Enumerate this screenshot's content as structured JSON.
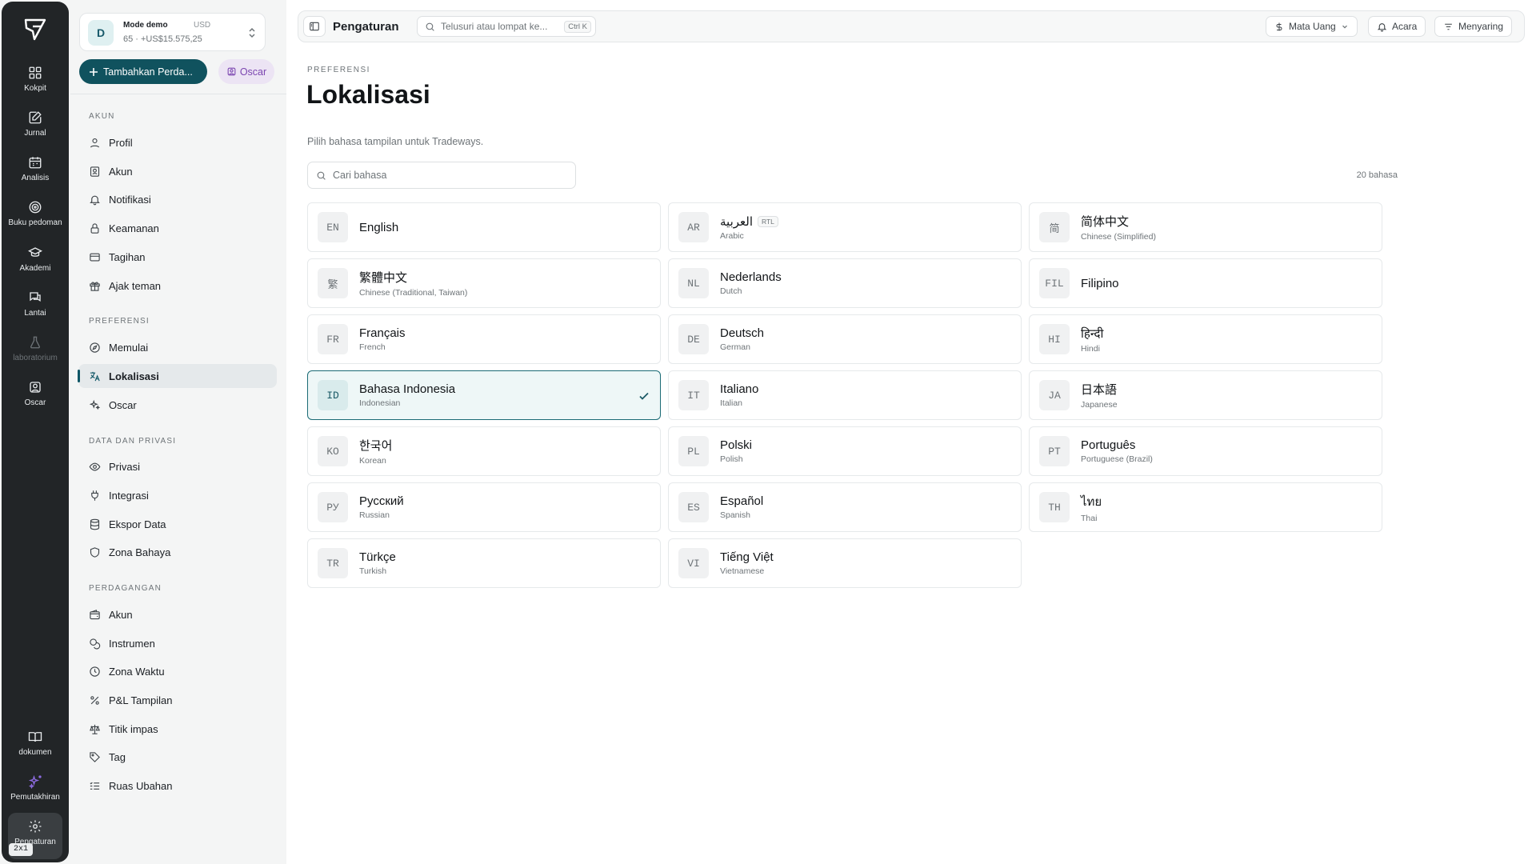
{
  "rail": {
    "items": [
      {
        "label": "Kokpit",
        "icon": "grid-icon"
      },
      {
        "label": "Jurnal",
        "icon": "edit-note-icon"
      },
      {
        "label": "Analisis",
        "icon": "calendar-icon"
      },
      {
        "label": "Buku pedoman",
        "icon": "target-icon"
      },
      {
        "label": "Akademi",
        "icon": "graduation-cap-icon"
      },
      {
        "label": "Lantai",
        "icon": "chat-icon"
      },
      {
        "label": "laboratorium",
        "icon": "flask-icon"
      },
      {
        "label": "Oscar",
        "icon": "bot-icon"
      }
    ],
    "bottom": [
      {
        "label": "dokumen",
        "icon": "book-icon"
      },
      {
        "label": "Pemutakhiran",
        "icon": "sparkles-icon"
      },
      {
        "label": "Pengaturan",
        "icon": "gear-icon"
      }
    ],
    "badge": "2x1"
  },
  "account": {
    "avatar": "D",
    "name": "Mode demo",
    "currency": "USD",
    "sub": "65 · +US$15.575,25"
  },
  "actions": {
    "add_label": "Tambahkan Perda...",
    "oscar_label": "Oscar"
  },
  "sidebar": {
    "sections": [
      {
        "title": "AKUN",
        "items": [
          "Profil",
          "Akun",
          "Notifikasi",
          "Keamanan",
          "Tagihan",
          "Ajak teman"
        ]
      },
      {
        "title": "PREFERENSI",
        "items": [
          "Memulai",
          "Lokalisasi",
          "Oscar"
        ]
      },
      {
        "title": "DATA DAN PRIVASI",
        "items": [
          "Privasi",
          "Integrasi",
          "Ekspor Data",
          "Zona Bahaya"
        ]
      },
      {
        "title": "PERDAGANGAN",
        "items": [
          "Akun",
          "Instrumen",
          "Zona Waktu",
          "P&L Tampilan",
          "Titik impas",
          "Tag",
          "Ruas Ubahan"
        ]
      }
    ],
    "active": "Lokalisasi"
  },
  "topbar": {
    "title": "Pengaturan",
    "search_placeholder": "Telusuri atau lompat ke...",
    "shortcut": "Ctrl K",
    "currency_label": "Mata Uang",
    "events_label": "Acara",
    "filter_label": "Menyaring"
  },
  "page": {
    "eyebrow": "PREFERENSI",
    "title": "Lokalisasi",
    "description": "Pilih bahasa tampilan untuk Tradeways.",
    "search_placeholder": "Cari bahasa",
    "count": "20 bahasa"
  },
  "accent_color": "#10525e",
  "languages": [
    {
      "code": "EN",
      "native": "English",
      "english": ""
    },
    {
      "code": "AR",
      "native": "العربية",
      "english": "Arabic",
      "badge": "RTL"
    },
    {
      "code": "简",
      "native": "简体中文",
      "english": "Chinese (Simplified)"
    },
    {
      "code": "繁",
      "native": "繁體中文",
      "english": "Chinese (Traditional, Taiwan)"
    },
    {
      "code": "NL",
      "native": "Nederlands",
      "english": "Dutch"
    },
    {
      "code": "FIL",
      "native": "Filipino",
      "english": ""
    },
    {
      "code": "FR",
      "native": "Français",
      "english": "French"
    },
    {
      "code": "DE",
      "native": "Deutsch",
      "english": "German"
    },
    {
      "code": "HI",
      "native": "हिन्दी",
      "english": "Hindi"
    },
    {
      "code": "ID",
      "native": "Bahasa Indonesia",
      "english": "Indonesian",
      "selected": true
    },
    {
      "code": "IT",
      "native": "Italiano",
      "english": "Italian"
    },
    {
      "code": "JA",
      "native": "日本語",
      "english": "Japanese"
    },
    {
      "code": "KO",
      "native": "한국어",
      "english": "Korean"
    },
    {
      "code": "PL",
      "native": "Polski",
      "english": "Polish"
    },
    {
      "code": "PT",
      "native": "Português",
      "english": "Portuguese (Brazil)"
    },
    {
      "code": "РУ",
      "native": "Русский",
      "english": "Russian"
    },
    {
      "code": "ES",
      "native": "Español",
      "english": "Spanish"
    },
    {
      "code": "TH",
      "native": "ไทย",
      "english": "Thai"
    },
    {
      "code": "TR",
      "native": "Türkçe",
      "english": "Turkish"
    },
    {
      "code": "VI",
      "native": "Tiếng Việt",
      "english": "Vietnamese"
    }
  ]
}
